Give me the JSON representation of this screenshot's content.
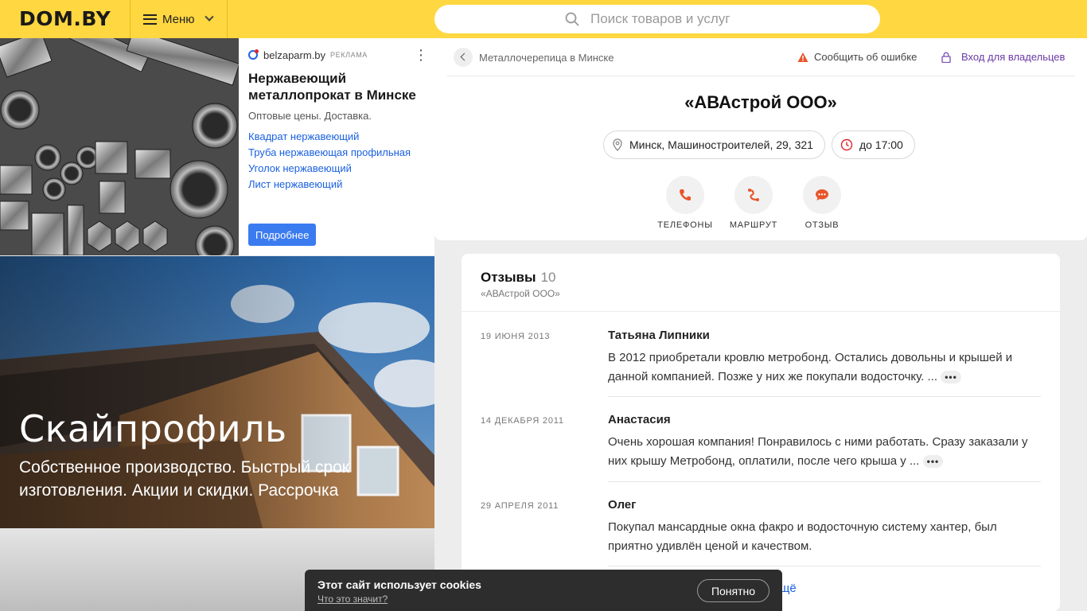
{
  "header": {
    "logo": "DOM.BY",
    "menu_label": "Меню",
    "search_placeholder": "Поиск товаров и услуг"
  },
  "ad": {
    "source": "belzaparm.by",
    "tag": "РЕКЛАМА",
    "title": "Нержавеющий металлопрокат в Минске",
    "description": "Оптовые цены. Доставка.",
    "links": [
      "Квадрат нержавеющий",
      "Труба нержавеющая профильная",
      "Уголок нержавеющий",
      "Лист нержавеющий"
    ],
    "button": "Подробнее"
  },
  "promo": {
    "title": "Скайпрофиль",
    "subtitle": "Собственное производство. Быстрый срок изготовления. Акции и скидки. Рассрочка"
  },
  "company": {
    "breadcrumb": "Металлочерепица в Минске",
    "report_error": "Сообщить об ошибке",
    "owner_login": "Вход для владельцев",
    "name": "«АВАстрой ООО»",
    "address": "Минск, Машиностроителей, 29, 321",
    "hours": "до 17:00",
    "actions": {
      "phones": "ТЕЛЕФОНЫ",
      "route": "МАРШРУТ",
      "review": "ОТЗЫВ"
    }
  },
  "reviews": {
    "title": "Отзывы",
    "count": "10",
    "subtitle": "«АВАстрой ООО»",
    "items": [
      {
        "date": "19 ИЮНЯ 2013",
        "author": "Татьяна Липники",
        "text": "В 2012 приобретали кровлю метробонд. Остались довольны и крышей и данной компанией. Позже у них же покупали водосточку. ..."
      },
      {
        "date": "14 ДЕКАБРЯ 2011",
        "author": "Анастасия",
        "text": "Очень хорошая компания! Понравилось с ними работать. Сразу заказали у них крышу Метробонд, оплатили, после чего крыша у ..."
      },
      {
        "date": "29 АПРЕЛЯ 2011",
        "author": "Олег",
        "text": "Покупал мансардные окна факро и водосточную систему хантер, был приятно удивлён ценой и качеством."
      }
    ],
    "more_link": "щё"
  },
  "cookie": {
    "title": "Этот сайт использует cookies",
    "link": "Что это значит?",
    "button": "Понятно"
  },
  "colors": {
    "header_bg": "#ffd740",
    "action_icon": "#e8552a",
    "link": "#1a61e0"
  }
}
